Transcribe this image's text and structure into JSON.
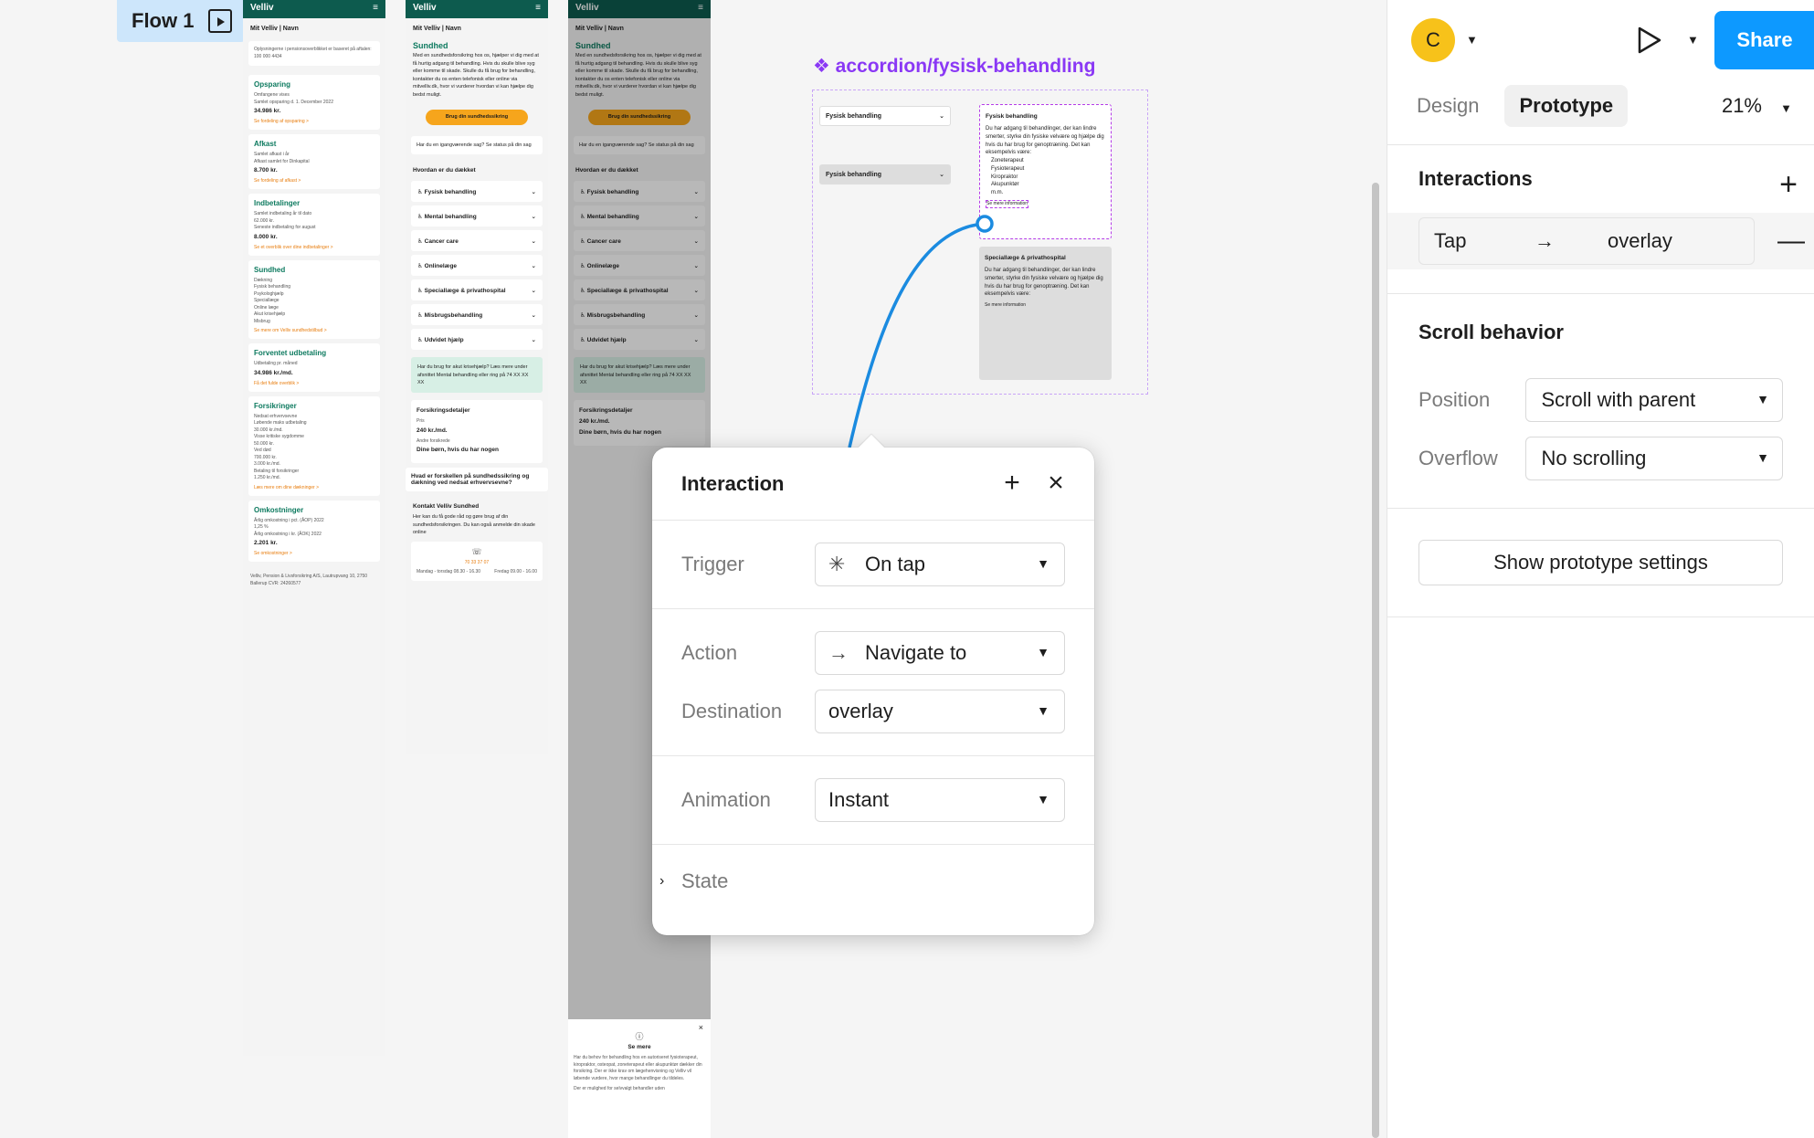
{
  "canvas": {
    "flow_label": "Flow 1",
    "component_title": "accordion/fysisk-behandling",
    "frame1": {
      "brand": "Velliv",
      "subnav": "Mit Velliv  |  Navn",
      "notice": "Oplysningerne i pensionsoverblikket er baseret på aftalen: 100 000 4434",
      "cards": [
        {
          "title": "Opsparing",
          "lines": [
            "Omfangene vises",
            "Samlet opsparing d. 1. December 2022"
          ],
          "value": "34.986 kr.",
          "link": "Se fordeling af opsparing >"
        },
        {
          "title": "Afkast",
          "lines": [
            "Samlet afkast i år",
            "Afkast samlet for Dinkapital"
          ],
          "value": "8.700 kr.",
          "link": "Se fordeling af afkast >"
        },
        {
          "title": "Indbetalinger",
          "lines": [
            "Samlet indbetaling år til dato",
            "62.000 kr.",
            "Seneste indbetaling for august"
          ],
          "value": "8.000 kr.",
          "link": "Se et overblik over dine indbetalinger >"
        },
        {
          "title": "Sundhed",
          "lines": [
            "Dækning",
            "Fysisk behandling",
            "Psykologhjælp",
            "Speciallæge",
            "Online læge",
            "Akut krisehjælp",
            "Misbrug"
          ],
          "value": "",
          "link": "Se mere om Velliv sundhedstilbud >"
        },
        {
          "title": "Forventet udbetaling",
          "lines": [
            "Udbetaling pr. måned"
          ],
          "value": "34.986 kr./md.",
          "link": "Få det fulde overblik >"
        },
        {
          "title": "Forsikringer",
          "lines": [
            "Nedsat erhvervsevne",
            "Løbende maks udbetaling",
            "30.000 kr./md.",
            "Visse kritiske sygdomme",
            "50.000 kr.",
            "Ved død",
            "700.000 kr.",
            "3.000 kr./md.",
            "Betaling til forsikringer",
            "1.250 kr./md."
          ],
          "value": "",
          "link": "Læs mere om dine dækninger >"
        },
        {
          "title": "Omkostninger",
          "lines": [
            "Årlig omkostning i pct. (ÅOP) 2022",
            "1,25 %",
            "Årlig omkostning i kr. (ÅOK) 2022"
          ],
          "value": "2.201 kr.",
          "link": "Se omkostninger >"
        }
      ],
      "footer": "Velliv, Pension & Livsforsikring A/S, Lautrupvang 10, 2750 Ballerup CVR: 24260577"
    },
    "frame2": {
      "brand": "Velliv",
      "subnav": "Mit Velliv  |  Navn",
      "title": "Sundhed",
      "intro": "Med en sundhedsforsikring hos os, hjælper vi dig med at få hurtig adgang til behandling. Hvis du skulle blive syg eller komme til skade. Skulle du få brug for behandling, kontakter du os enten telefonisk eller online via mitvelliv.dk, hvor vi vurderer hvordan vi kan hjælpe dig bedst muligt.",
      "button": "Brug din sundhedssikring",
      "info": "Har du en igangværende sag? Se status på din sag",
      "section": "Hvordan er du dækket",
      "accordions": [
        "Fysisk behandling",
        "Mental behandling",
        "Cancer care",
        "Onlinelæge",
        "Speciallæge & privathospital",
        "Misbrugsbehandling",
        "Udvidet hjælp"
      ],
      "crisis": "Har du brug for akut krisehjælp? Læs mere under afsnittet  Mental behandling eller ring på 74 XX XX XX",
      "details_title": "Forsikringsdetaljer",
      "price_label": "Pris",
      "price": "240 kr./md.",
      "other_label": "Andre forsikrede",
      "other": "Dine børn, hvis du har nogen",
      "question": "Hvad er forskellen på sundhedssikring og dækning ved nedsat erhvervsevne?",
      "contact_title": "Kontakt Velliv Sundhed",
      "contact_text": "Her kan du få gode råd og gøre brug af din sundhedsforsikringen. Du kan også anmelde din skade online",
      "phone": "70 33 37 07",
      "hours_a": "Mandag - torsdag 08.30 - 16.30",
      "hours_b": "Fredag 09.00 - 16.00"
    },
    "overlay": {
      "title": "Se mere",
      "text": "Har du behov for behandling hos en autoriseret fysioterapeut, kiropraktor, osteopat, zoneterapeut eller akupunktør dækker din forsikring. Der er ikke krav om lægehenvisning og Velliv vil løbende vurdere, hvor mange behandlinger du tildeles.",
      "more": "Der er mulighed for selvvalgt behandler uden"
    },
    "component": {
      "closed_a": "Fysisk behandling",
      "closed_b": "Fysisk behandling",
      "open_title": "Fysisk behandling",
      "open_text": "Du har adgang til behandlinger, der kan lindre smerter, styrke din fysiske velvære og hjælpe dig hvis du har brug for genoptræning. Det kan eksempelvis være:",
      "open_list": [
        "Zoneterapeut",
        "Fysioterapeut",
        "Kiropraktor",
        "Akupunktør",
        "m.m."
      ],
      "open_link": "Se mere information",
      "open2_title": "Speciallæge & privathospital"
    }
  },
  "dialog": {
    "title": "Interaction",
    "trigger_label": "Trigger",
    "trigger_value": "On tap",
    "action_label": "Action",
    "action_value": "Navigate to",
    "destination_label": "Destination",
    "destination_value": "overlay",
    "animation_label": "Animation",
    "animation_value": "Instant",
    "state_label": "State"
  },
  "panel": {
    "avatar_initial": "C",
    "share_label": "Share",
    "tabs": [
      "Design",
      "Prototype"
    ],
    "active_tab": "Prototype",
    "zoom": "21%",
    "interactions_title": "Interactions",
    "interaction": {
      "trigger": "Tap",
      "destination": "overlay"
    },
    "scroll_title": "Scroll behavior",
    "position_label": "Position",
    "position_value": "Scroll with parent",
    "overflow_label": "Overflow",
    "overflow_value": "No scrolling",
    "settings_button": "Show prototype settings"
  },
  "colors": {
    "accent": "#0d99ff",
    "component": "#8a38f5",
    "brand": "#0d5b4e",
    "orange": "#f6a51c",
    "avatar": "#f7c21a"
  }
}
